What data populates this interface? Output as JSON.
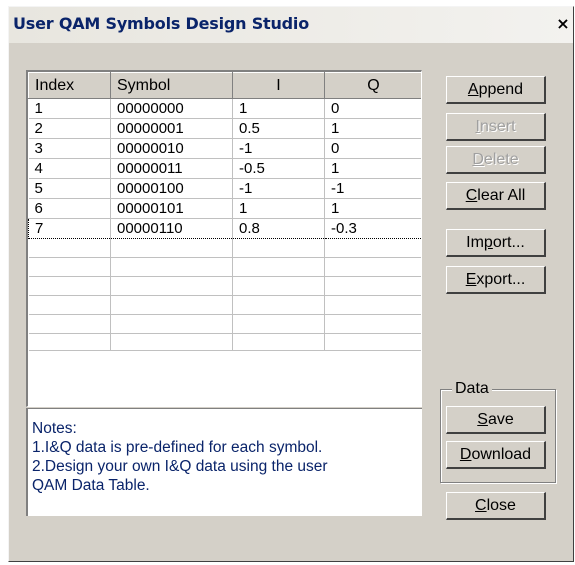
{
  "window": {
    "title": "User QAM Symbols Design Studio",
    "close_glyph": "×"
  },
  "table": {
    "columns": [
      "Index",
      "Symbol",
      "I",
      "Q"
    ],
    "rows": [
      [
        "1",
        "00000000",
        "1",
        "0"
      ],
      [
        "2",
        "00000001",
        "0.5",
        "1"
      ],
      [
        "3",
        "00000010",
        "-1",
        "0"
      ],
      [
        "4",
        "00000011",
        "-0.5",
        "1"
      ],
      [
        "5",
        "00000100",
        "-1",
        "-1"
      ],
      [
        "6",
        "00000101",
        "1",
        "1"
      ],
      [
        "7",
        "00000110",
        "0.8",
        "-0.3"
      ]
    ],
    "selected_row": 7
  },
  "notes": {
    "lines": [
      "Notes:",
      "1.I&Q data is pre-defined for each symbol.",
      "2.Design your own I&Q data using the user",
      "QAM Data Table."
    ]
  },
  "buttons": {
    "append": {
      "pre": "",
      "key": "A",
      "post": "ppend"
    },
    "insert": {
      "pre": "",
      "key": "I",
      "post": "nsert"
    },
    "delete": {
      "pre": "",
      "key": "D",
      "post": "elete"
    },
    "clear_all": {
      "pre": "",
      "key": "C",
      "post": "lear All"
    },
    "import": {
      "pre": "Im",
      "key": "p",
      "post": "ort..."
    },
    "export": {
      "pre": "",
      "key": "E",
      "post": "xport..."
    },
    "save": {
      "pre": "",
      "key": "S",
      "post": "ave"
    },
    "download": {
      "pre": "",
      "key": "D",
      "post": "ownload"
    },
    "close": {
      "pre": "",
      "key": "C",
      "post": "lose"
    }
  },
  "data_group": {
    "label": "Data"
  }
}
